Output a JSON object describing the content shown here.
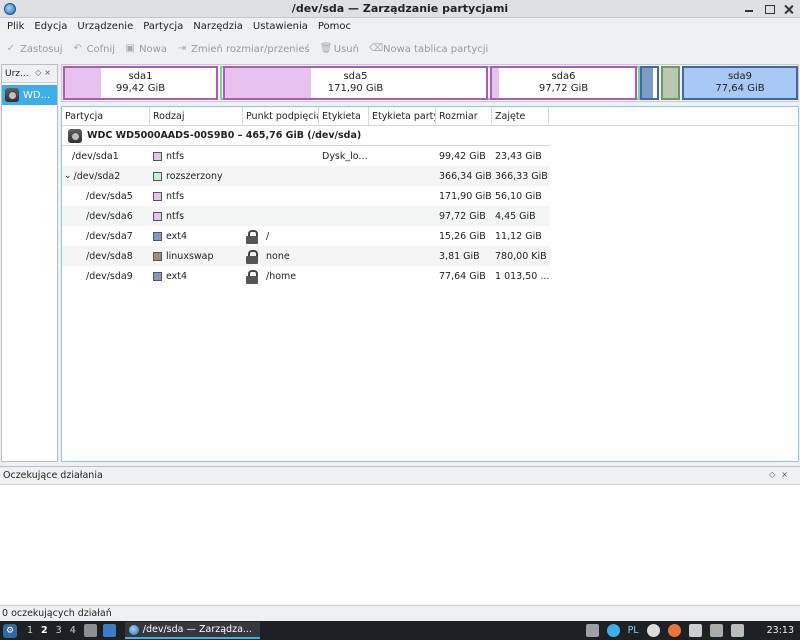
{
  "window": {
    "title": "/dev/sda — Zarządzanie partycjami"
  },
  "menu": [
    "Plik",
    "Edycja",
    "Urządzenie",
    "Partycja",
    "Narzędzia",
    "Ustawienia",
    "Pomoc"
  ],
  "toolbar": [
    {
      "icon": "check-icon",
      "label": "Zastosuj"
    },
    {
      "icon": "undo-icon",
      "label": "Cofnij"
    },
    {
      "icon": "new-icon",
      "label": "Nowa"
    },
    {
      "icon": "resize-icon",
      "label": "Zmień rozmiar/przenieś"
    },
    {
      "icon": "trash-icon",
      "label": "Usuń"
    },
    {
      "icon": "partition-table-icon",
      "label": "Nowa tablica partycji"
    }
  ],
  "device_panel": {
    "title": "Urz...",
    "device_label": "WD..."
  },
  "partition_map": [
    {
      "name": "sda1",
      "size": "99,42 GiB",
      "used_fraction": 0.24,
      "fill_color": "#e7c2ee",
      "border_color": "#aa5cb8"
    },
    {
      "name": "sda5",
      "size": "171,90 GiB",
      "used_fraction": 0.33,
      "fill_color": "#e7c2ee",
      "border_color": "#aa5cb8"
    },
    {
      "name": "sda6",
      "size": "97,72 GiB",
      "used_fraction": 0.05,
      "fill_color": "#e7c2ee",
      "border_color": "#aa5cb8"
    },
    {
      "name": "",
      "size": "",
      "used_fraction": 0.73,
      "fill_color": "#7a9cc6",
      "border_color": "#3f6aa0"
    },
    {
      "name": "",
      "size": "",
      "used_fraction": 1.0,
      "fill_color": "#b9c9b0",
      "border_color": "#77916a"
    },
    {
      "name": "sda9",
      "size": "77,64 GiB",
      "used_fraction": 1.0,
      "fill_color": "#a9c9f5",
      "border_color": "#3f6aa0"
    }
  ],
  "extended_color": "#7ed29a",
  "table": {
    "columns": [
      "Partycja",
      "Rodzaj",
      "Punkt podpięcia",
      "Etykieta",
      "Etykieta party",
      "Rozmiar",
      "Zajęte"
    ],
    "disk": "WDC WD5000AADS-00S9B0 – 465,76 GiB (/dev/sda)",
    "rows": [
      {
        "partition": "/dev/sda1",
        "type": "ntfs",
        "color": "#e7c2ee",
        "mount": "",
        "locked": false,
        "label": "Dysk_lo...",
        "plabel": "",
        "size": "99,42 GiB",
        "used": "23,43 GiB",
        "level": 0,
        "expander": ""
      },
      {
        "partition": "/dev/sda2",
        "type": "rozszerzony",
        "color": "#c3f0cf",
        "mount": "",
        "locked": false,
        "label": "",
        "plabel": "",
        "size": "366,34 GiB",
        "used": "366,33 GiB",
        "level": 0,
        "expander": "⌄"
      },
      {
        "partition": "/dev/sda5",
        "type": "ntfs",
        "color": "#e7c2ee",
        "mount": "",
        "locked": false,
        "label": "",
        "plabel": "",
        "size": "171,90 GiB",
        "used": "56,10 GiB",
        "level": 1,
        "expander": ""
      },
      {
        "partition": "/dev/sda6",
        "type": "ntfs",
        "color": "#e7c2ee",
        "mount": "",
        "locked": false,
        "label": "",
        "plabel": "",
        "size": "97,72 GiB",
        "used": "4,45 GiB",
        "level": 1,
        "expander": ""
      },
      {
        "partition": "/dev/sda7",
        "type": "ext4",
        "color": "#7a9cc6",
        "mount": "/",
        "locked": true,
        "label": "",
        "plabel": "",
        "size": "15,26 GiB",
        "used": "11,12 GiB",
        "level": 1,
        "expander": ""
      },
      {
        "partition": "/dev/sda8",
        "type": "linuxswap",
        "color": "#9e8d76",
        "mount": "none",
        "locked": true,
        "label": "",
        "plabel": "",
        "size": "3,81 GiB",
        "used": "780,00 KiB",
        "level": 1,
        "expander": ""
      },
      {
        "partition": "/dev/sda9",
        "type": "ext4",
        "color": "#7a9cc6",
        "mount": "/home",
        "locked": true,
        "label": "",
        "plabel": "",
        "size": "77,64 GiB",
        "used": "1 013,50 ...",
        "level": 1,
        "expander": ""
      }
    ]
  },
  "pending_panel": {
    "title": "Oczekujące działania"
  },
  "status": "0 oczekujących działań",
  "taskbar": {
    "workspaces": [
      "1",
      "2",
      "3",
      "4"
    ],
    "active_workspace": "2",
    "task_label": "/dev/sda — Zarządza...",
    "keyboard_layout": "PL",
    "clock": "23:13"
  }
}
